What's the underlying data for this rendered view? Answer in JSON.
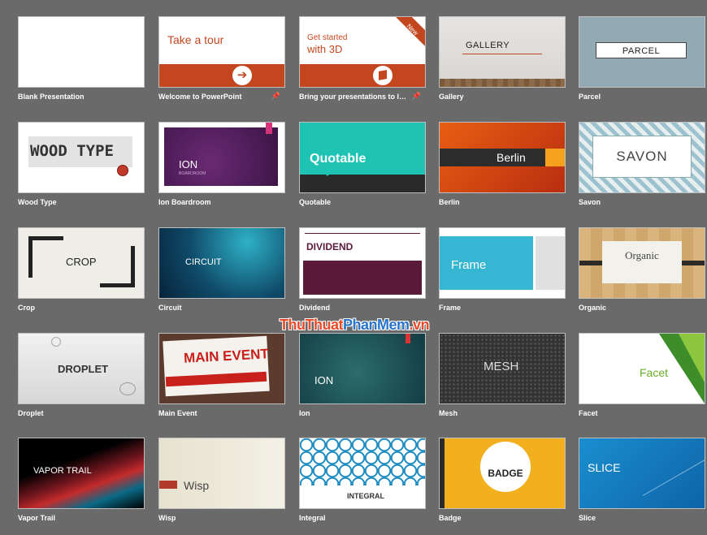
{
  "templates": [
    {
      "label": "Blank Presentation"
    },
    {
      "label": "Welcome to PowerPoint",
      "thumb_text": "Take a tour",
      "pinned": true
    },
    {
      "label": "Bring your presentations to life...",
      "thumb_text_1": "Get started",
      "thumb_text_2": "with 3D",
      "ribbon": "New",
      "pinned": true
    },
    {
      "label": "Gallery",
      "thumb_text": "GALLERY"
    },
    {
      "label": "Parcel",
      "thumb_text": "PARCEL"
    },
    {
      "label": "Wood Type",
      "thumb_text": "WOOD TYPE"
    },
    {
      "label": "Ion Boardroom",
      "thumb_text": "ION",
      "thumb_sub": "BOARDROOM"
    },
    {
      "label": "Quotable",
      "thumb_text": "Quotable"
    },
    {
      "label": "Berlin",
      "thumb_text": "Berlin"
    },
    {
      "label": "Savon",
      "thumb_text": "SAVON"
    },
    {
      "label": "Crop",
      "thumb_text": "CROP"
    },
    {
      "label": "Circuit",
      "thumb_text": "CIRCUIT"
    },
    {
      "label": "Dividend",
      "thumb_text": "DIVIDEND"
    },
    {
      "label": "Frame",
      "thumb_text": "Frame"
    },
    {
      "label": "Organic",
      "thumb_text": "Organic"
    },
    {
      "label": "Droplet",
      "thumb_text": "DROPLET"
    },
    {
      "label": "Main Event",
      "thumb_text": "MAIN EVENT"
    },
    {
      "label": "Ion",
      "thumb_text": "ION"
    },
    {
      "label": "Mesh",
      "thumb_text": "MESH"
    },
    {
      "label": "Facet",
      "thumb_text": "Facet"
    },
    {
      "label": "Vapor Trail",
      "thumb_text": "VAPOR TRAIL"
    },
    {
      "label": "Wisp",
      "thumb_text": "Wisp"
    },
    {
      "label": "Integral",
      "thumb_text": "INTEGRAL"
    },
    {
      "label": "Badge",
      "thumb_text": "BADGE"
    },
    {
      "label": "Slice",
      "thumb_text": "SLICE"
    }
  ],
  "watermark": {
    "part1": "ThuThuat",
    "part2": "PhanMem",
    "part3": ".vn"
  },
  "icons": {
    "pin": "pin-icon",
    "arrow": "arrow-right-icon",
    "cube": "cube-3d-icon"
  }
}
